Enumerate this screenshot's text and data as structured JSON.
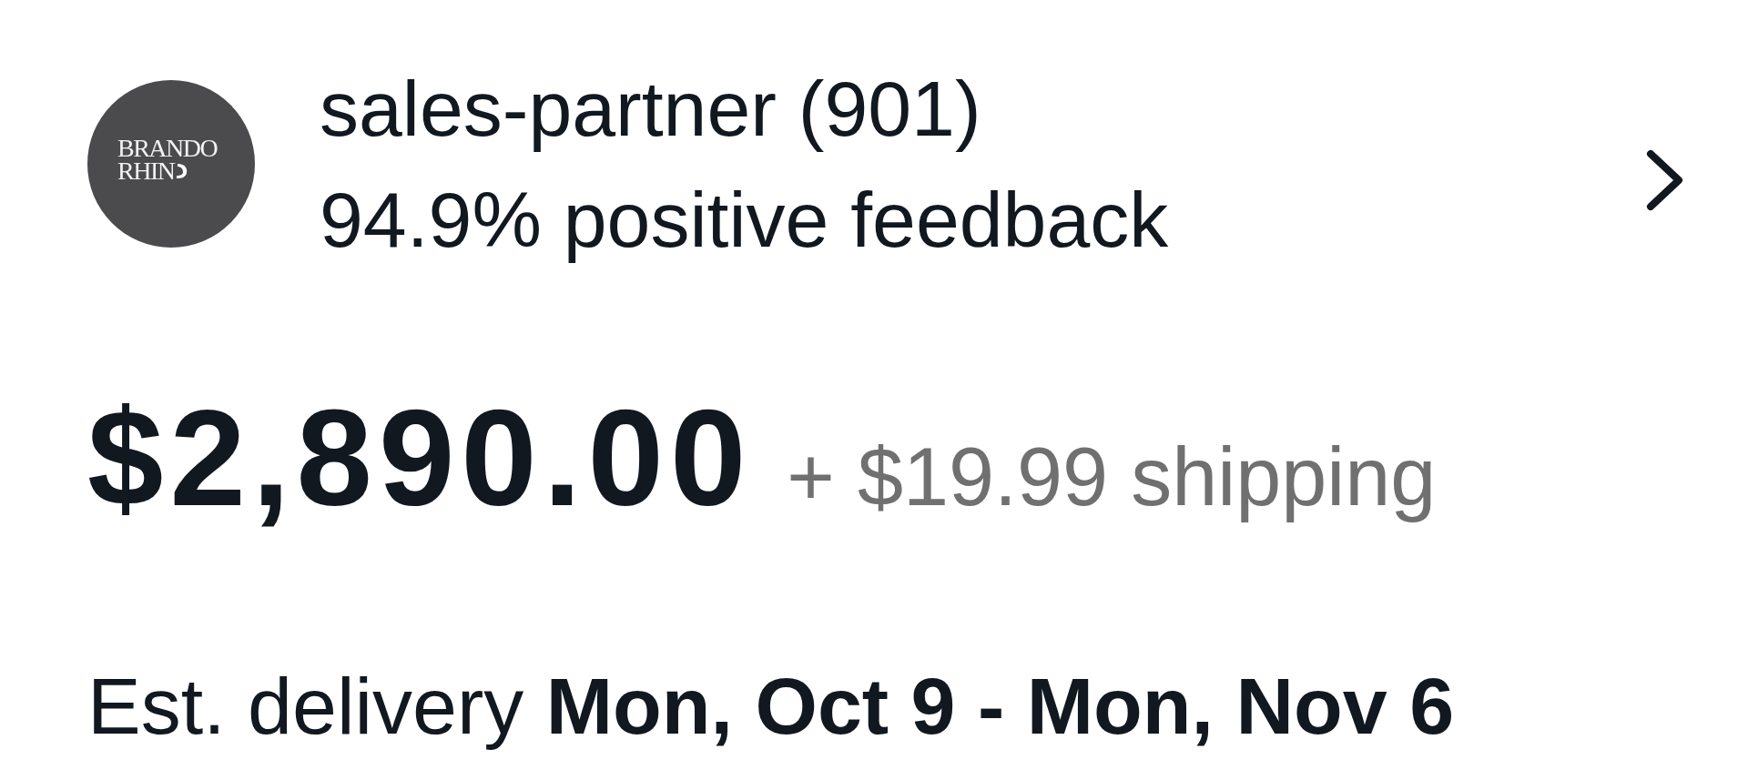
{
  "seller": {
    "logo": {
      "lines": [
        "BRANDO",
        "RHIN"
      ]
    },
    "name": "sales-partner (901)",
    "feedback": "94.9% positive feedback"
  },
  "price": {
    "amount": "$2,890.00",
    "shipping": "+ $19.99 shipping"
  },
  "delivery": {
    "text": "Est. delivery **Mon, Oct 9 - Mon, Nov 6**"
  }
}
